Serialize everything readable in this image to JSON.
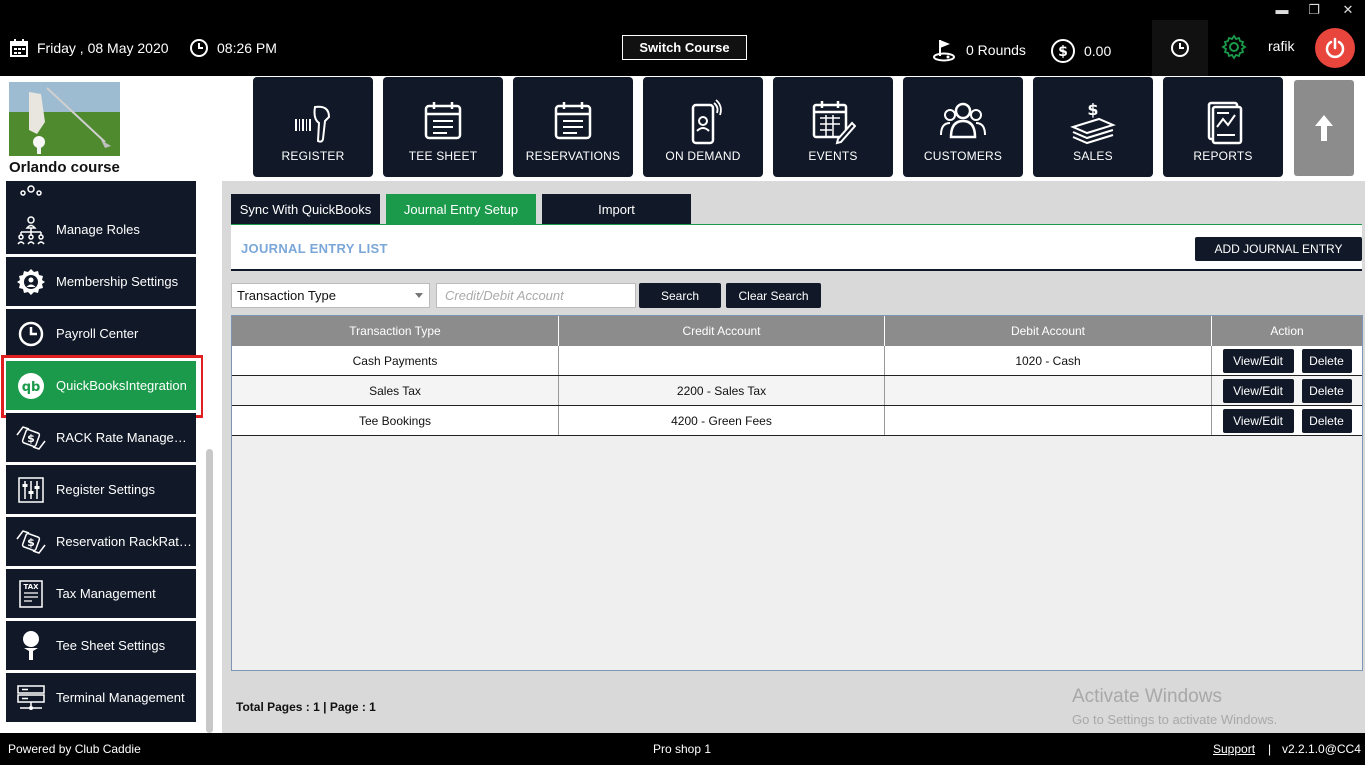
{
  "topbar": {
    "date": "Friday ,  08 May 2020",
    "time": "08:26 PM",
    "switch_course": "Switch Course",
    "rounds": "0 Rounds",
    "balance": "0.00",
    "user": "rafik",
    "window_controls": [
      "▬",
      "❐",
      "✕"
    ]
  },
  "header": {
    "course_name": "Orlando course",
    "nav": [
      {
        "label": "REGISTER",
        "icon": "barcode-scanner-icon"
      },
      {
        "label": "TEE SHEET",
        "icon": "tee-sheet-icon"
      },
      {
        "label": "RESERVATIONS",
        "icon": "reservations-icon"
      },
      {
        "label": "ON DEMAND",
        "icon": "mobile-phone-icon"
      },
      {
        "label": "EVENTS",
        "icon": "calendar-edit-icon"
      },
      {
        "label": "CUSTOMERS",
        "icon": "customers-icon"
      },
      {
        "label": "SALES",
        "icon": "cash-icon"
      },
      {
        "label": "REPORTS",
        "icon": "report-icon"
      }
    ]
  },
  "sidebar": {
    "items": [
      {
        "label": "Manage Roles",
        "icon": "org-chart-icon"
      },
      {
        "label": "Membership Settings",
        "icon": "gear-user-icon"
      },
      {
        "label": "Payroll Center",
        "icon": "clock-icon"
      },
      {
        "label": "QuickBooksIntegration",
        "icon": "quickbooks-icon"
      },
      {
        "label": "RACK Rate Manageme...",
        "icon": "rate-exchange-icon"
      },
      {
        "label": "Register Settings",
        "icon": "sliders-icon"
      },
      {
        "label": "Reservation RackRate...",
        "icon": "rate-exchange-icon"
      },
      {
        "label": "Tax Management",
        "icon": "tax-document-icon"
      },
      {
        "label": "Tee Sheet Settings",
        "icon": "golf-tee-icon"
      },
      {
        "label": "Terminal Management",
        "icon": "server-icon"
      }
    ]
  },
  "tabs": [
    "Sync With QuickBooks",
    "Journal Entry Setup",
    "Import"
  ],
  "panel": {
    "title": "JOURNAL ENTRY LIST",
    "add_button": "ADD JOURNAL ENTRY"
  },
  "filters": {
    "transaction_type": "Transaction Type",
    "account_placeholder": "Credit/Debit Account",
    "search": "Search",
    "clear": "Clear Search"
  },
  "table": {
    "headers": [
      "Transaction Type",
      "Credit Account",
      "Debit Account",
      "Action"
    ],
    "rows": [
      {
        "type": "Cash Payments",
        "credit": "",
        "debit": "1020 - Cash"
      },
      {
        "type": "Sales Tax",
        "credit": "2200 - Sales Tax",
        "debit": ""
      },
      {
        "type": "Tee Bookings",
        "credit": "4200 - Green Fees",
        "debit": ""
      }
    ],
    "view_edit": "View/Edit",
    "delete": "Delete"
  },
  "pager": "Total Pages : 1 | Page : 1",
  "watermark": {
    "line1": "Activate Windows",
    "line2": "Go to Settings to activate Windows."
  },
  "footer": {
    "powered": "Powered by Club Caddie",
    "shop": "Pro shop 1",
    "support": "Support",
    "version": "v2.2.1.0@CC4"
  },
  "colors": {
    "dark": "#111827",
    "green": "#1a9a4a",
    "red": "#e8453c",
    "title_blue": "#7aa7d8"
  }
}
